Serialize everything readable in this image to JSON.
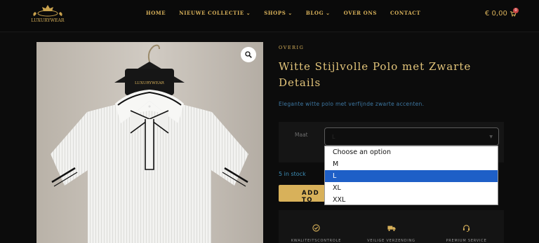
{
  "header": {
    "logo_text": "LUXURYWEAR",
    "nav": [
      {
        "label": "HOME",
        "has_dropdown": false
      },
      {
        "label": "NIEUWE COLLECTIE",
        "has_dropdown": true
      },
      {
        "label": "SHOPS",
        "has_dropdown": true
      },
      {
        "label": "BLOG",
        "has_dropdown": true
      },
      {
        "label": "OVER ONS",
        "has_dropdown": false
      },
      {
        "label": "CONTACT",
        "has_dropdown": false
      }
    ],
    "cart_total": "€ 0,00",
    "cart_count": "0"
  },
  "product": {
    "category": "OVERIG",
    "title_line1": "Witte Stijlvolle Polo met Zwarte",
    "title_line2": "Details",
    "description": "Elegante witte polo met verfijnde zwarte accenten.",
    "hanger_brand": "LUXURYWEAR"
  },
  "variation": {
    "label": "Maat",
    "selected": "L",
    "options": [
      "Choose an option",
      "M",
      "L",
      "XL",
      "XXL"
    ]
  },
  "stock": "5 in stock",
  "add_to_cart_visible": "ADD TO",
  "features": [
    {
      "label": "KWALITEITSCONTROLE",
      "icon": "check-circle-icon"
    },
    {
      "label": "VEILIGE VERZENDING",
      "icon": "truck-icon"
    },
    {
      "label": "PREMIUM SERVICE",
      "icon": "headset-icon"
    }
  ],
  "colors": {
    "gold": "#d8b15a",
    "background": "#0c0c0c",
    "highlight": "#1e5fc7",
    "badge": "#c94444"
  }
}
